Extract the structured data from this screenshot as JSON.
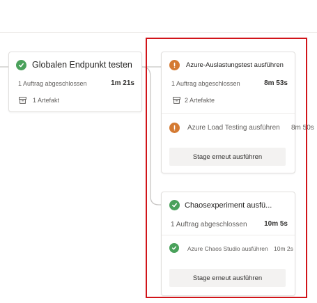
{
  "colors": {
    "success": "#4aa15b",
    "warning": "#d47a33",
    "highlight": "#d11419"
  },
  "stage_endpoint": {
    "status_icon": "check-circle-icon",
    "title": "Globalen Endpunkt testen",
    "jobs_text": "1 Auftrag abgeschlossen",
    "duration": "1m 21s",
    "artifact_icon": "artifact-icon",
    "artifacts_text": "1 Artefakt"
  },
  "stage_load": {
    "status_icon": "warning-circle-icon",
    "title": "Azure-Auslastungstest ausführen",
    "jobs_text": "1 Auftrag abgeschlossen",
    "duration": "8m 53s",
    "artifact_icon": "artifact-icon",
    "artifacts_text": "2 Artefakte",
    "job_name": "Azure Load Testing ausführen",
    "job_duration": "8m 50s",
    "rerun_label": "Stage erneut ausführen"
  },
  "stage_chaos": {
    "status_icon": "check-circle-icon",
    "title": "Chaosexperiment ausfü...",
    "jobs_text": "1 Auftrag abgeschlossen",
    "duration": "10m 5s",
    "job_name": "Azure Chaos Studio ausführen",
    "job_duration": "10m 2s",
    "rerun_label": "Stage erneut ausführen"
  }
}
